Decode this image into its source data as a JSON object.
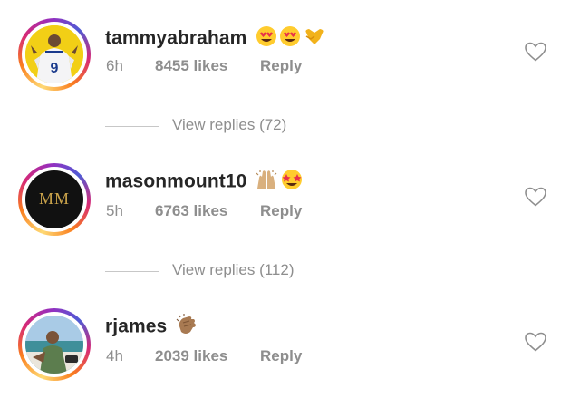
{
  "comments": [
    {
      "username": "tammyabraham",
      "emojis": [
        "heart-eyes",
        "heart-eyes",
        "yellow-heart"
      ],
      "age": "6h",
      "likes": "8455 likes",
      "reply_label": "Reply",
      "view_replies": "View replies (72)"
    },
    {
      "username": "masonmount10",
      "emojis": [
        "raising-hands",
        "star-struck"
      ],
      "age": "5h",
      "likes": "6763 likes",
      "reply_label": "Reply",
      "avatar_text": "MM",
      "view_replies": "View replies (112)"
    },
    {
      "username": "rjames",
      "emojis": [
        "clapping-hands"
      ],
      "age": "4h",
      "likes": "2039 likes",
      "reply_label": "Reply"
    }
  ],
  "colors": {
    "text": "#262626",
    "secondary": "#8e8e8e",
    "divider": "#c7c7c7"
  }
}
